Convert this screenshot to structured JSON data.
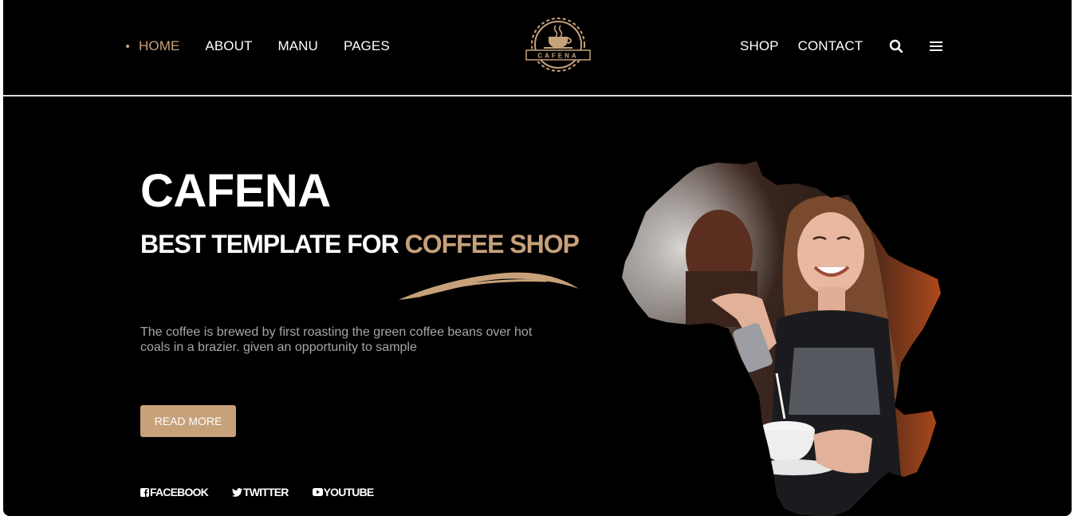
{
  "nav": {
    "home": "HOME",
    "about": "ABOUT",
    "menu": "MANU",
    "pages": "PAGES",
    "shop": "SHOP",
    "contact": "CONTACT"
  },
  "logo": {
    "text": "CAFENA"
  },
  "hero": {
    "title": "CAFENA",
    "subtitle_main": "BEST TEMPLATE FOR ",
    "subtitle_accent": "COFFEE SHOP",
    "description": "The coffee is brewed by first roasting the green coffee beans over hot coals in a brazier. given an opportunity to sample",
    "button": "READ MORE"
  },
  "socials": {
    "facebook": "FACEBOOK",
    "twitter": "TWITTER",
    "youtube": "YOUTUBE"
  },
  "icons": {
    "search": "search-icon",
    "menu": "hamburger-icon",
    "logo": "coffee-cup-icon"
  },
  "colors": {
    "accent": "#c7a17a",
    "background": "#000000",
    "text": "#ffffff",
    "muted_text": "#a6a6a6"
  }
}
